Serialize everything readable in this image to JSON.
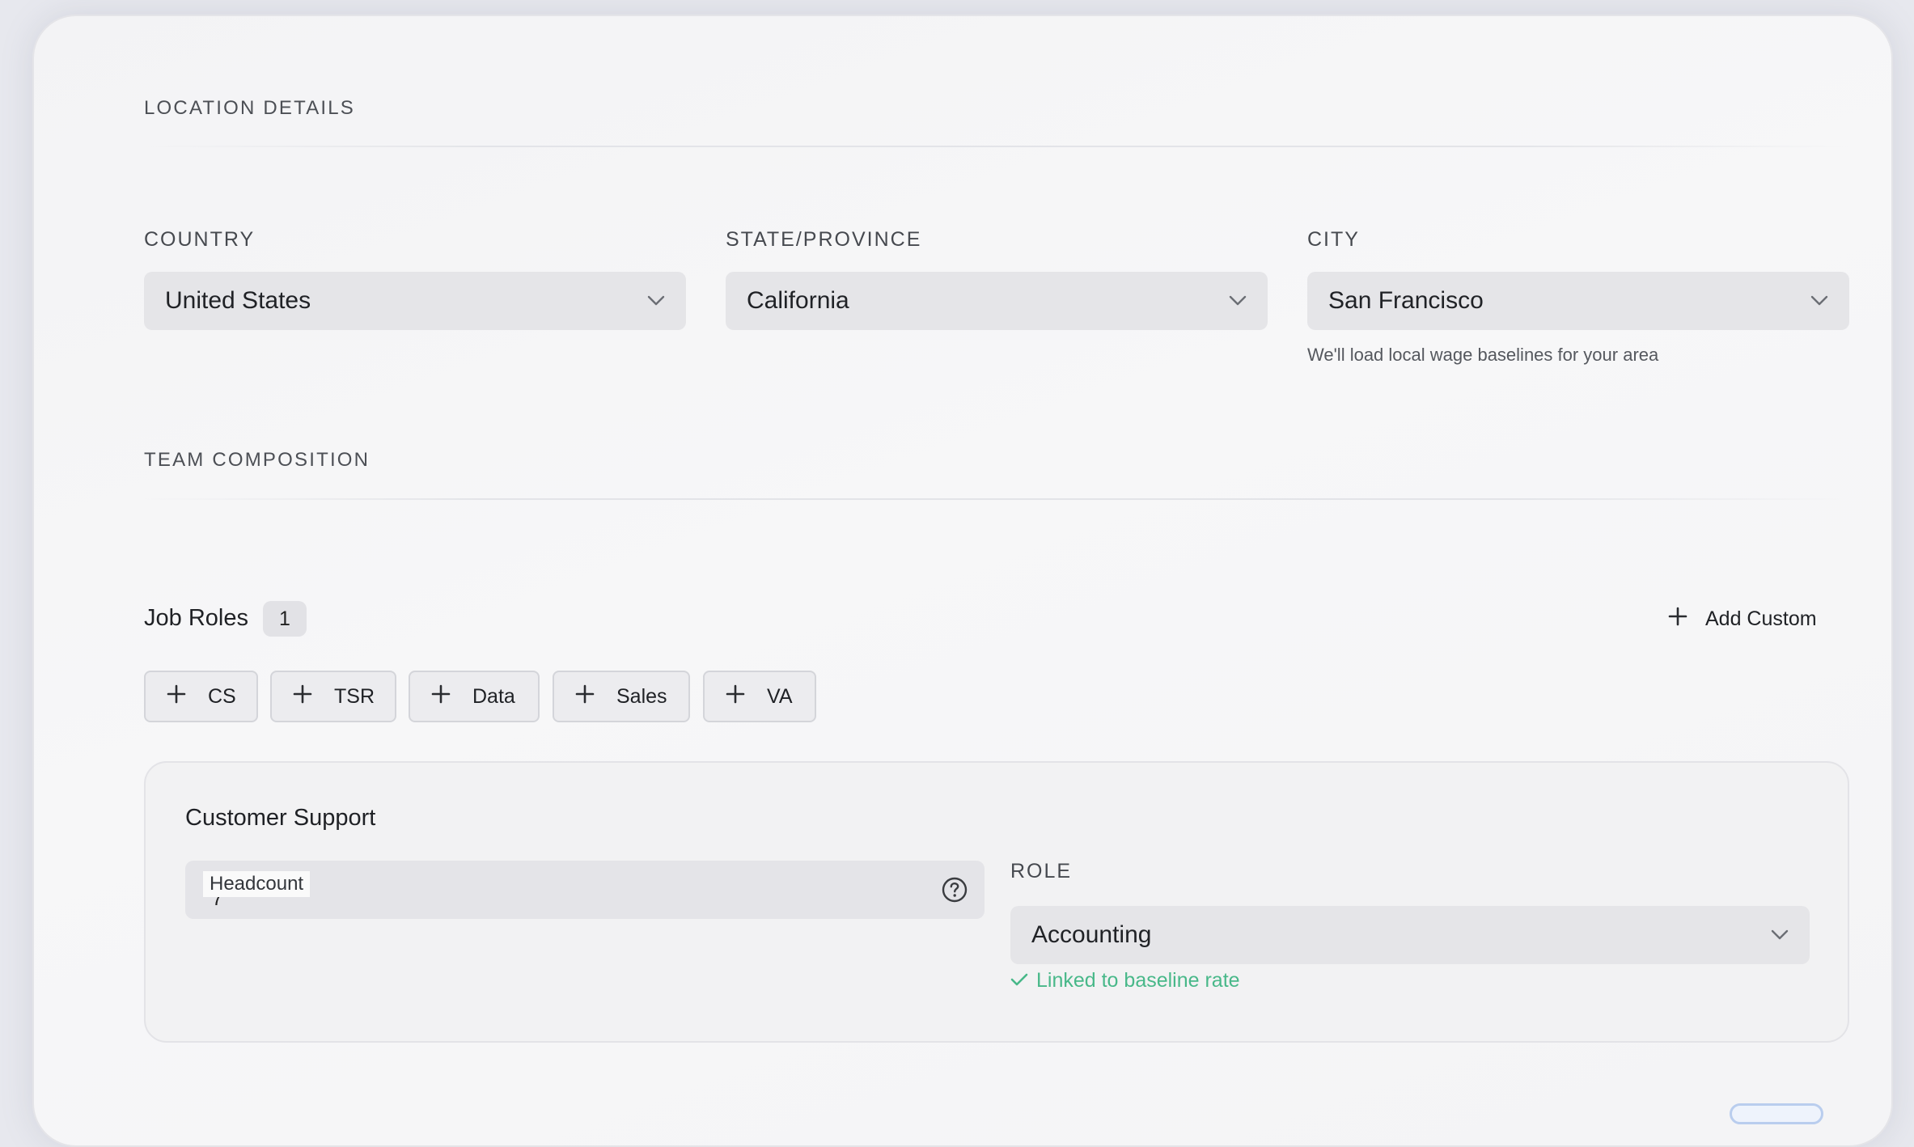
{
  "location": {
    "section_title": "LOCATION DETAILS",
    "country": {
      "label": "COUNTRY",
      "value": "United States"
    },
    "state": {
      "label": "STATE/PROVINCE",
      "value": "California"
    },
    "city": {
      "label": "CITY",
      "value": "San Francisco",
      "helper": "We'll load local wage baselines for your area"
    }
  },
  "team": {
    "section_title": "TEAM COMPOSITION",
    "job_roles_label": "Job Roles",
    "job_roles_count": "1",
    "add_custom_label": "Add Custom",
    "chips": [
      {
        "label": "CS",
        "icon": "plus-icon"
      },
      {
        "label": "TSR",
        "icon": "plus-icon"
      },
      {
        "label": "Data",
        "icon": "plus-icon"
      },
      {
        "label": "Sales",
        "icon": "plus-icon"
      },
      {
        "label": "VA",
        "icon": "plus-icon"
      }
    ],
    "role_card": {
      "title": "Customer Support",
      "headcount_label": "Headcount",
      "headcount_value": "7",
      "role_label": "ROLE",
      "role_value": "Accounting",
      "linked_text": "Linked to baseline rate"
    }
  },
  "colors": {
    "accent_success": "#48b889",
    "field_bg": "#e5e5e8",
    "card_bg": "#f5f5f7"
  }
}
